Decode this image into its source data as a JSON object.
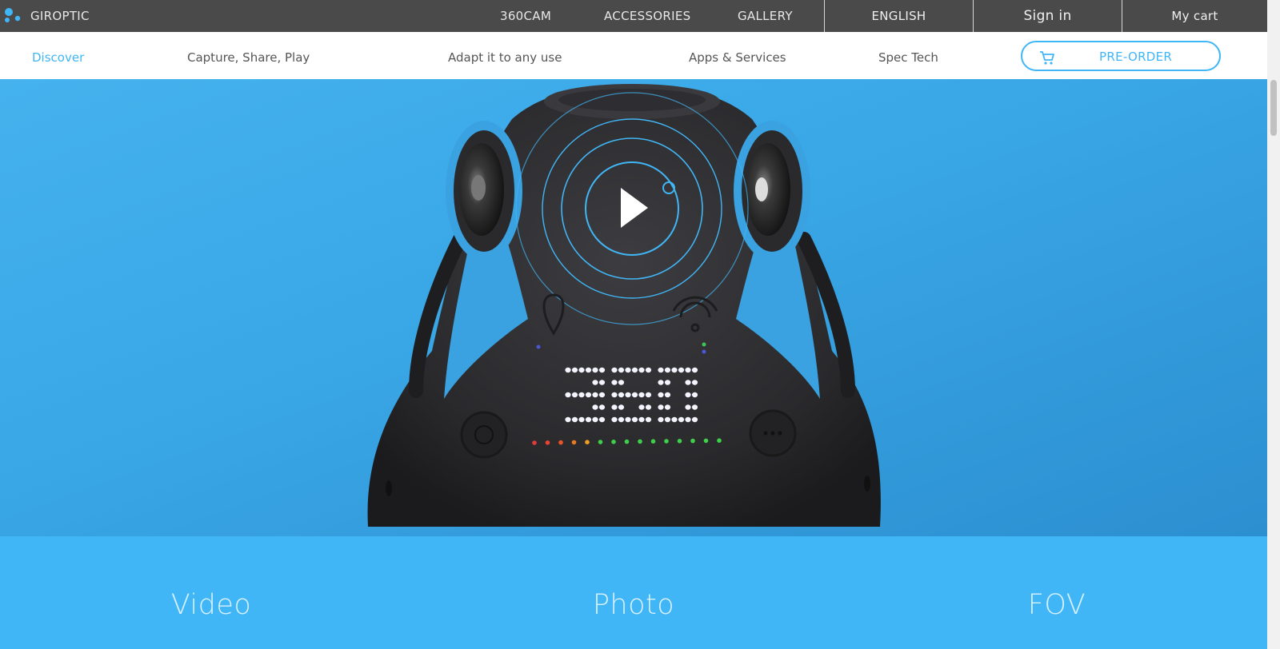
{
  "header": {
    "brand": "GIROPTIC",
    "nav": [
      {
        "label": "360CAM"
      },
      {
        "label": "ACCESSORIES"
      },
      {
        "label": "GALLERY"
      }
    ],
    "language": "ENGLISH",
    "sign_in": "Sign in",
    "cart": "My cart"
  },
  "subnav": {
    "items": [
      {
        "label": "Discover"
      },
      {
        "label": "Capture, Share, Play"
      },
      {
        "label": "Adapt it to any use"
      },
      {
        "label": "Apps & Services"
      },
      {
        "label": "Spec Tech"
      }
    ],
    "preorder_label": "PRE-ORDER"
  },
  "hero": {
    "display_text": "360"
  },
  "features": [
    {
      "title": "Video"
    },
    {
      "title": "Photo"
    },
    {
      "title": "FOV"
    }
  ],
  "colors": {
    "accent": "#41b6f6",
    "topbar": "#4a4a4a",
    "camera_body": "#2b2b2e"
  }
}
